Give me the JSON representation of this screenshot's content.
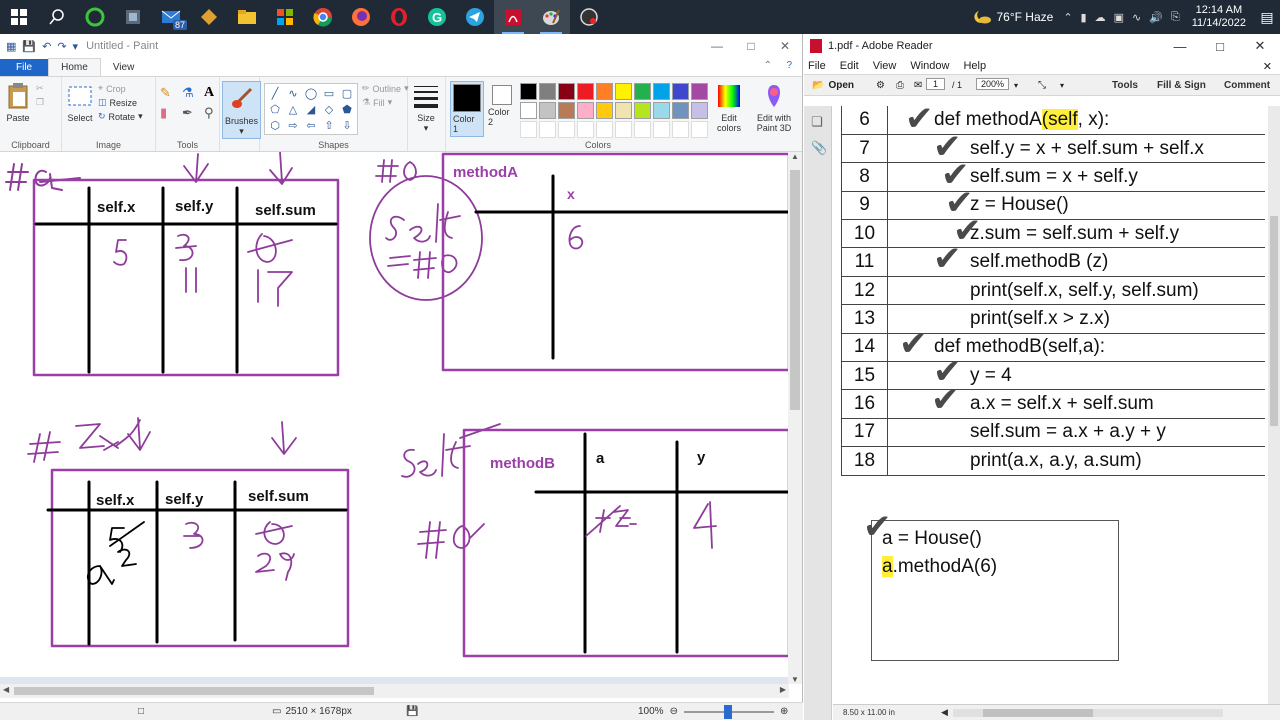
{
  "taskbar": {
    "mail_badge": "87",
    "weather": "76°F  Haze",
    "time": "12:14 AM",
    "date": "11/14/2022"
  },
  "paint": {
    "title": "Untitled - Paint",
    "tabs": [
      "File",
      "Home",
      "View"
    ],
    "clipboard": {
      "paste": "Paste",
      "label": "Clipboard"
    },
    "image": {
      "select": "Select",
      "crop": "Crop",
      "resize": "Resize",
      "rotate": "Rotate",
      "label": "Image"
    },
    "tools": {
      "label": "Tools"
    },
    "brushes": "Brushes",
    "shapes": {
      "outline": "Outline",
      "fill": "Fill",
      "label": "Shapes"
    },
    "size": "Size",
    "color1": "Color 1",
    "color2": "Color 2",
    "edit_colors": "Edit colors",
    "edit_paint3d": "Edit with Paint 3D",
    "colors_label": "Colors",
    "palette": [
      "#000000",
      "#7f7f7f",
      "#880015",
      "#ed1c24",
      "#ff7f27",
      "#fff200",
      "#22b14c",
      "#00a2e8",
      "#3f48cc",
      "#a349a4",
      "#ffffff",
      "#c3c3c3",
      "#b97a57",
      "#ffaec9",
      "#ffc90e",
      "#efe4b0",
      "#b5e61d",
      "#99d9ea",
      "#7092be",
      "#c8bfe7"
    ],
    "drawing": {
      "t1": {
        "h1": "self.x",
        "h2": "self.y",
        "h3": "self.sum"
      },
      "t2": {
        "title": "methodA",
        "h1": "x"
      },
      "t3": {
        "h1": "self.x",
        "h2": "self.y",
        "h3": "self.sum"
      },
      "t4": {
        "title": "methodB",
        "h1": "a",
        "h2": "y"
      }
    },
    "status": {
      "dims": "2510 × 1678px",
      "zoom": "100%"
    }
  },
  "adobe": {
    "title": "1.pdf - Adobe Reader",
    "menu": [
      "File",
      "Edit",
      "View",
      "Window",
      "Help"
    ],
    "toolbar": {
      "open": "Open",
      "page": "1",
      "of": "/ 1",
      "zoom": "200%",
      "tools": "Tools",
      "fill_sign": "Fill & Sign",
      "comment": "Comment"
    },
    "code": [
      {
        "n": "6",
        "pre": "def methodA",
        "hl": "(self",
        "post": ", x):"
      },
      {
        "n": "7",
        "text": "self.y = x + self.sum + self.x"
      },
      {
        "n": "8",
        "text": "self.sum = x + self.y"
      },
      {
        "n": "9",
        "text": "z = House()"
      },
      {
        "n": "10",
        "text": "z.sum = self.sum + self.y"
      },
      {
        "n": "11",
        "text": "self.methodB (z)"
      },
      {
        "n": "12",
        "text": "print(self.x, self.y, self.sum)"
      },
      {
        "n": "13",
        "text": "print(self.x > z.x)"
      },
      {
        "n": "14",
        "text": "def methodB(self,a):"
      },
      {
        "n": "15",
        "text": "y = 4"
      },
      {
        "n": "16",
        "text": "a.x = self.x + self.sum"
      },
      {
        "n": "17",
        "text": "self.sum = a.x + a.y + y"
      },
      {
        "n": "18",
        "text": "print(a.x, a.y, a.sum)"
      }
    ],
    "main": {
      "line1": "a = House()",
      "line2_hl": "a",
      "line2_rest": ".methodA(6)"
    },
    "status": "8.50 x 11.00 in"
  }
}
